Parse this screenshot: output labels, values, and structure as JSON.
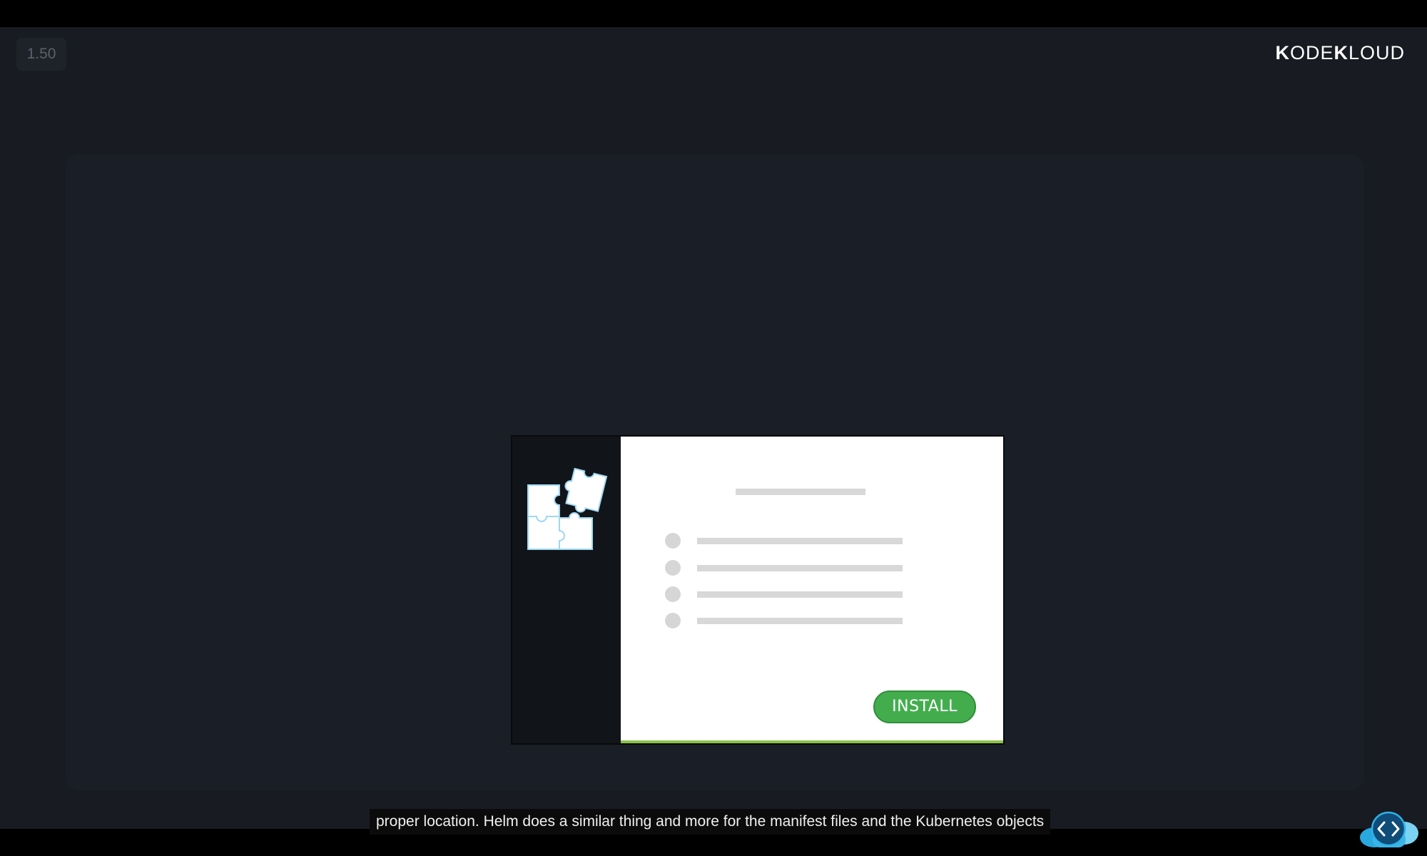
{
  "player": {
    "speed_label": "1.50",
    "caption": "proper location. Helm does a similar thing and more for the manifest files and the Kubernetes objects"
  },
  "brand": {
    "logo_part1": "K",
    "logo_part2": "ODE",
    "logo_part3": "K",
    "logo_part4": "LOUD"
  },
  "installer": {
    "install_label": "INSTALL",
    "options_count_visible": 4
  },
  "icons": {
    "puzzle": "puzzle-pieces-icon",
    "code": "code-brackets-icon",
    "cloud": "cloud-icon"
  },
  "colors": {
    "background": "#181c22",
    "slide": "#1a1e26",
    "install_button": "#43ad4e",
    "progress_bar": "#8bc24a",
    "puzzle_fill": "#ffffff",
    "puzzle_outline": "#9fd8f2",
    "cloud": "#29a8e0"
  }
}
